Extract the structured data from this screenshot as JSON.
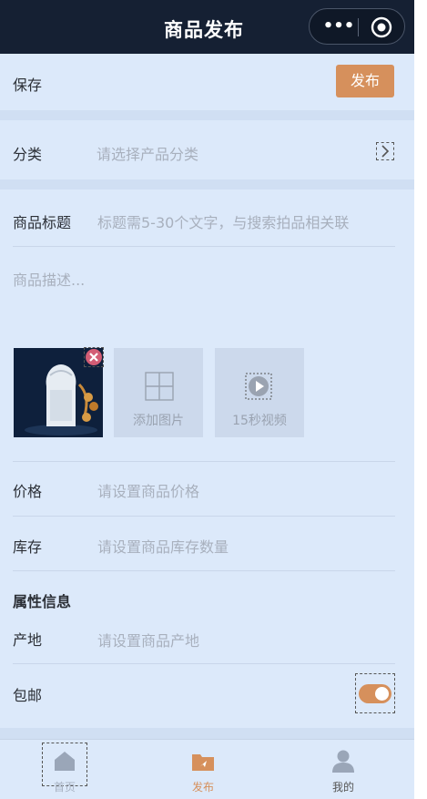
{
  "navbar": {
    "title": "商品发布",
    "more_glyph": "•••",
    "more_icon": "more-dots-icon",
    "target_icon": "record-target-icon"
  },
  "header_row": {
    "save_label": "保存",
    "publish_label": "发布"
  },
  "category": {
    "label": "分类",
    "placeholder": "请选择产品分类",
    "chevron_icon": "chevron-right-icon"
  },
  "title_field": {
    "label": "商品标题",
    "placeholder": "标题需5-30个文字，与搜索拍品相关联"
  },
  "description": {
    "placeholder": "商品描述..."
  },
  "media": {
    "delete_icon": "delete-x-icon",
    "add_image_label": "添加图片",
    "add_image_icon": "add-grid-icon",
    "video_label": "15秒视频",
    "video_icon": "play-icon"
  },
  "price": {
    "label": "价格",
    "placeholder": "请设置商品价格"
  },
  "stock": {
    "label": "库存",
    "placeholder": "请设置商品库存数量"
  },
  "attributes": {
    "heading": "属性信息"
  },
  "origin": {
    "label": "产地",
    "placeholder": "请设置商品产地"
  },
  "shipping": {
    "label": "包邮",
    "enabled": true
  },
  "tabbar": {
    "items": [
      {
        "label": "首页",
        "icon": "home-icon",
        "active": false
      },
      {
        "label": "发布",
        "icon": "publish-folder-icon",
        "active": true
      },
      {
        "label": "我的",
        "icon": "user-icon",
        "active": false
      }
    ]
  },
  "colors": {
    "accent": "#d6905c",
    "navbar_bg": "#152033",
    "page_bg": "#dce9fa",
    "placeholder": "#a8b0bd"
  }
}
